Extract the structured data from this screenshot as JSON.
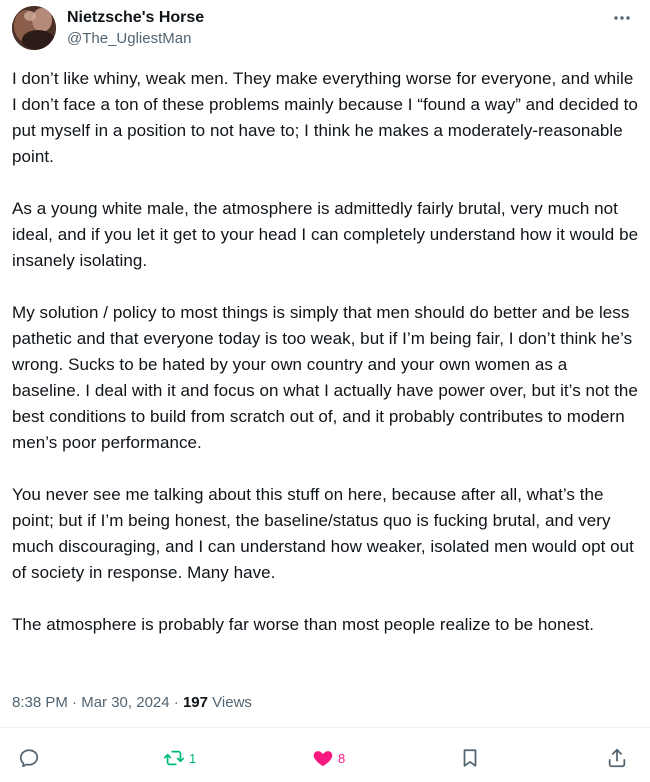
{
  "author": {
    "display_name": "Nietzsche's Horse",
    "handle": "@The_UgliestMan"
  },
  "tweet": {
    "paragraphs": [
      "I don’t like whiny, weak men. They make everything worse for everyone, and while I don’t face a ton of these problems mainly because I “found a way” and decided to put myself in a position to not have to; I think he makes a moderately-reasonable point.",
      "As a young white male, the atmosphere is admittedly fairly brutal, very much not ideal, and if you let it get to your head I can completely understand how it would be insanely isolating.",
      "My solution / policy to most things is simply that men should do better and be less pathetic and that everyone today is too weak, but if I’m being fair, I don’t think he’s wrong. Sucks to be hated by your own country and your own women as a baseline. I deal with it and focus on what I actually have power over, but it’s not the best conditions to build from scratch out of, and it probably contributes to modern men’s poor performance.",
      "You never see me talking about this stuff on here, because after all, what’s the point; but if I’m being honest, the baseline/status quo is fucking brutal, and very much discouraging, and I can understand how weaker, isolated men would opt out of society in response. Many have.",
      "The atmosphere is probably far worse than most people realize to be honest."
    ],
    "time": "8:38 PM",
    "separator": "·",
    "date": "Mar 30, 2024",
    "views_count": "197",
    "views_label": "Views"
  },
  "actions": {
    "reply_icon": "reply-icon",
    "retweet_icon": "retweet-icon",
    "retweet_count": "1",
    "like_icon": "heart-filled-icon",
    "like_count": "8",
    "bookmark_icon": "bookmark-icon",
    "share_icon": "share-icon"
  },
  "colors": {
    "text_primary": "#0f1419",
    "text_secondary": "#536471",
    "retweet_green": "#00ba7c",
    "like_pink": "#f91880",
    "divider": "#eff3f4"
  }
}
